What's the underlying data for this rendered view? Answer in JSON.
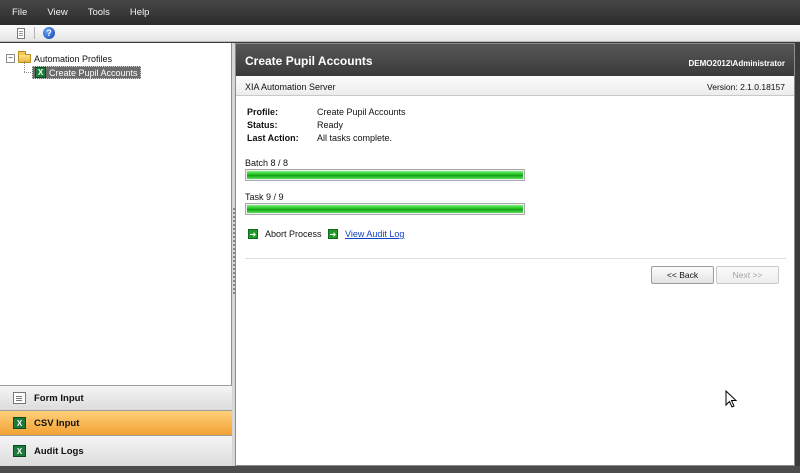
{
  "menu": {
    "items": [
      "File",
      "View",
      "Tools",
      "Help"
    ]
  },
  "toolbar": {
    "icons": [
      "document-icon",
      "help-icon"
    ],
    "help_glyph": "?"
  },
  "tree": {
    "root": {
      "label": "Automation Profiles",
      "expander": "−"
    },
    "child": {
      "label": "Create Pupil Accounts",
      "icon_glyph": "X"
    }
  },
  "nav": {
    "form_input": "Form Input",
    "csv_input": "CSV Input",
    "audit_logs": "Audit Logs"
  },
  "panel": {
    "title": "Create Pupil Accounts",
    "user": "DEMO2012\\Administrator",
    "server": "XIA Automation Server",
    "version": "Version: 2.1.0.18157"
  },
  "info": {
    "profile_label": "Profile:",
    "profile_value": "Create Pupil Accounts",
    "status_label": "Status:",
    "status_value": "Ready",
    "last_action_label": "Last Action:",
    "last_action_value": "All tasks complete."
  },
  "progress": {
    "batch": {
      "label": "Batch 8 / 8",
      "value": 8,
      "max": 8
    },
    "task": {
      "label": "Task 9 / 9",
      "value": 9,
      "max": 9
    }
  },
  "actions": {
    "abort": "Abort Process",
    "view_log": "View Audit Log"
  },
  "buttons": {
    "back": "<< Back",
    "next": "Next >>"
  },
  "colors": {
    "accent_orange": "#f2a233",
    "progress_green": "#1fbf1f",
    "link_blue": "#1342c4"
  }
}
